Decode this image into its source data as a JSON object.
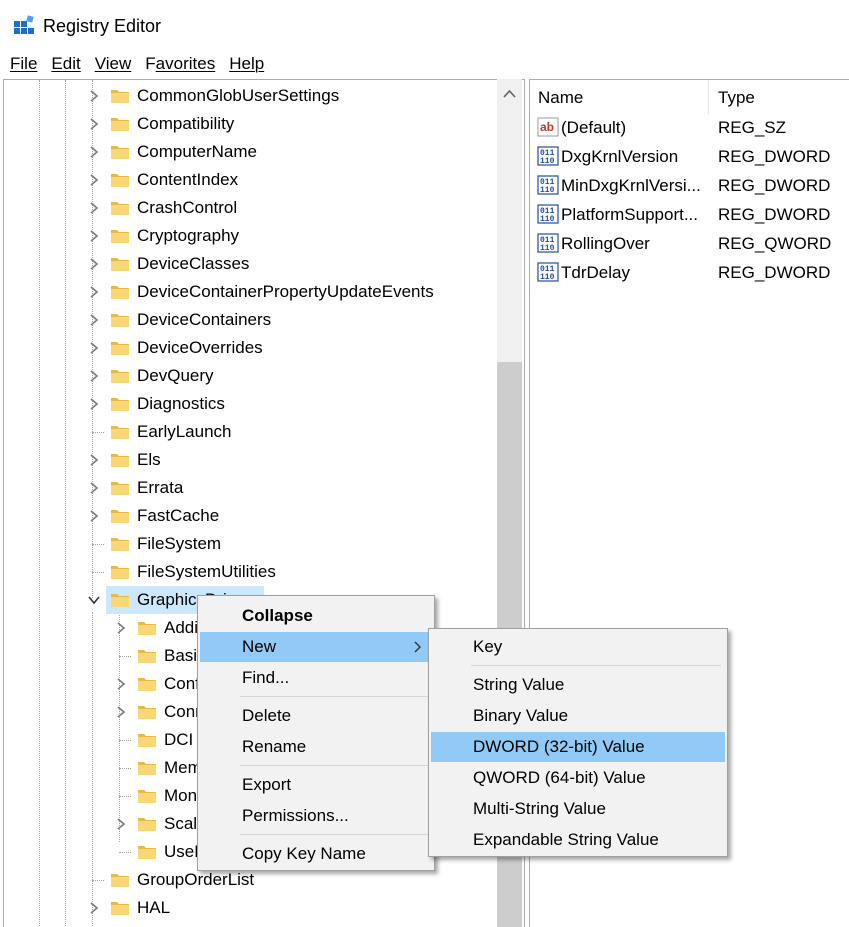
{
  "window": {
    "title": "Registry Editor",
    "icon": "registry-editor-icon"
  },
  "menubar": [
    {
      "key": "F",
      "rest": "ile"
    },
    {
      "key": "E",
      "rest": "dit"
    },
    {
      "key": "V",
      "rest": "iew"
    },
    {
      "key": "F",
      "rest": "avorites",
      "pre": ""
    },
    {
      "key": "H",
      "rest": "elp"
    }
  ],
  "tree": {
    "items": [
      {
        "label": "CommonGlobUserSettings",
        "expandable": true
      },
      {
        "label": "Compatibility",
        "expandable": true
      },
      {
        "label": "ComputerName",
        "expandable": true
      },
      {
        "label": "ContentIndex",
        "expandable": true
      },
      {
        "label": "CrashControl",
        "expandable": true
      },
      {
        "label": "Cryptography",
        "expandable": true
      },
      {
        "label": "DeviceClasses",
        "expandable": true
      },
      {
        "label": "DeviceContainerPropertyUpdateEvents",
        "expandable": true
      },
      {
        "label": "DeviceContainers",
        "expandable": true
      },
      {
        "label": "DeviceOverrides",
        "expandable": true
      },
      {
        "label": "DevQuery",
        "expandable": true
      },
      {
        "label": "Diagnostics",
        "expandable": true
      },
      {
        "label": "EarlyLaunch",
        "expandable": false
      },
      {
        "label": "Els",
        "expandable": true
      },
      {
        "label": "Errata",
        "expandable": true
      },
      {
        "label": "FastCache",
        "expandable": true
      },
      {
        "label": "FileSystem",
        "expandable": false
      },
      {
        "label": "FileSystemUtilities",
        "expandable": false
      },
      {
        "label": "GraphicsDrivers",
        "expandable": true,
        "expanded": true,
        "selected": true
      },
      {
        "label": "AdditionalModeLists",
        "expandable": true,
        "child": true
      },
      {
        "label": "BasicDisplay",
        "expandable": false,
        "child": true
      },
      {
        "label": "Configuration",
        "expandable": true,
        "child": true
      },
      {
        "label": "Connectivity",
        "expandable": true,
        "child": true
      },
      {
        "label": "DCI",
        "expandable": false,
        "child": true
      },
      {
        "label": "MemoryManager",
        "expandable": false,
        "child": true
      },
      {
        "label": "MonitorDataStore",
        "expandable": false,
        "child": true
      },
      {
        "label": "ScaleFactors",
        "expandable": true,
        "child": true
      },
      {
        "label": "UseNewKey",
        "expandable": false,
        "child": true
      },
      {
        "label": "GroupOrderList",
        "expandable": false
      },
      {
        "label": "HAL",
        "expandable": true
      }
    ]
  },
  "values": {
    "headers": {
      "name": "Name",
      "type": "Type"
    },
    "rows": [
      {
        "name": "(Default)",
        "type": "REG_SZ",
        "icon": "string-value-icon"
      },
      {
        "name": "DxgKrnlVersion",
        "type": "REG_DWORD",
        "icon": "binary-value-icon"
      },
      {
        "name": "MinDxgKrnlVersi...",
        "type": "REG_DWORD",
        "icon": "binary-value-icon"
      },
      {
        "name": "PlatformSupport...",
        "type": "REG_DWORD",
        "icon": "binary-value-icon"
      },
      {
        "name": "RollingOver",
        "type": "REG_QWORD",
        "icon": "binary-value-icon"
      },
      {
        "name": "TdrDelay",
        "type": "REG_DWORD",
        "icon": "binary-value-icon"
      }
    ]
  },
  "context_menu": {
    "items": [
      "Collapse",
      "New",
      "Find...",
      "Delete",
      "Rename",
      "Export",
      "Permissions...",
      "Copy Key Name"
    ],
    "highlighted": "New"
  },
  "submenu": {
    "items": [
      "Key",
      "String Value",
      "Binary Value",
      "DWORD (32-bit) Value",
      "QWORD (64-bit) Value",
      "Multi-String Value",
      "Expandable String Value"
    ],
    "highlighted": "DWORD (32-bit) Value"
  },
  "colors": {
    "selection": "#cce8ff",
    "menu_highlight": "#91c9f7",
    "folder": "#f8d775"
  }
}
